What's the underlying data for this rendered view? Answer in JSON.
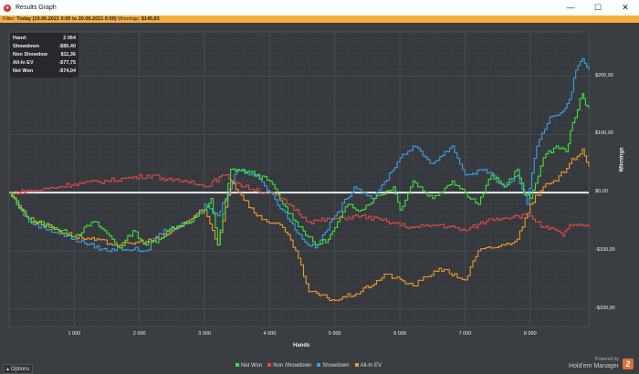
{
  "window": {
    "title": "Results Graph",
    "minimize": "—",
    "maximize": "☐",
    "close": "✕"
  },
  "filter": {
    "label": "Filter:",
    "value": "Today (19.06.2021 0:00 to 20.06.2021 0:00)",
    "winnings_label": "Winnings:",
    "winnings": "$145,83"
  },
  "stats": [
    {
      "label": "Hand:",
      "value": "2 064"
    },
    {
      "label": "Showdown",
      "value": "-$85,40"
    },
    {
      "label": "Non Showdow",
      "value": "$11,36"
    },
    {
      "label": "All-In EV",
      "value": "-$77,75"
    },
    {
      "label": "Net Won",
      "value": "-$74,04"
    }
  ],
  "footer": {
    "options": "Options",
    "powered_by": "Powered by",
    "brand": "Hold'em Manager",
    "brand_mark": "2"
  },
  "chart_data": {
    "type": "line",
    "xlabel": "Hands",
    "ylabel": "Winnings",
    "xlim": [
      0,
      8900
    ],
    "ylim": [
      -230,
      276
    ],
    "xticks": [
      {
        "v": 1000,
        "label": "1 000"
      },
      {
        "v": 2000,
        "label": "2 000"
      },
      {
        "v": 3000,
        "label": "3 000"
      },
      {
        "v": 4000,
        "label": "4 000"
      },
      {
        "v": 5000,
        "label": "5 000"
      },
      {
        "v": 6000,
        "label": "6 000"
      },
      {
        "v": 7000,
        "label": "7 000"
      },
      {
        "v": 8000,
        "label": "8 000"
      }
    ],
    "yticks": [
      {
        "v": 200,
        "label": "$200,00"
      },
      {
        "v": 100,
        "label": "$100,00"
      },
      {
        "v": 0,
        "label": "$0,00"
      },
      {
        "v": -100,
        "label": "-$100,00"
      },
      {
        "v": -200,
        "label": "-$200,00"
      }
    ],
    "legend_position": "bottom",
    "series": [
      {
        "name": "Net Won",
        "color": "#3ee03a",
        "points": [
          [
            0,
            0
          ],
          [
            300,
            -45
          ],
          [
            700,
            -60
          ],
          [
            1000,
            -75
          ],
          [
            1300,
            -50
          ],
          [
            1500,
            -70
          ],
          [
            1700,
            -95
          ],
          [
            1900,
            -65
          ],
          [
            2100,
            -90
          ],
          [
            2300,
            -80
          ],
          [
            2500,
            -60
          ],
          [
            2800,
            -50
          ],
          [
            3000,
            -30
          ],
          [
            3100,
            -10
          ],
          [
            3200,
            -90
          ],
          [
            3400,
            40
          ],
          [
            3700,
            35
          ],
          [
            4000,
            20
          ],
          [
            4200,
            -20
          ],
          [
            4400,
            -50
          ],
          [
            4700,
            -90
          ],
          [
            4900,
            -80
          ],
          [
            5000,
            -60
          ],
          [
            5200,
            -20
          ],
          [
            5400,
            -30
          ],
          [
            5600,
            -10
          ],
          [
            5900,
            10
          ],
          [
            6000,
            -30
          ],
          [
            6200,
            20
          ],
          [
            6500,
            -10
          ],
          [
            6800,
            20
          ],
          [
            7000,
            0
          ],
          [
            7200,
            -20
          ],
          [
            7400,
            30
          ],
          [
            7600,
            10
          ],
          [
            7800,
            40
          ],
          [
            7900,
            0
          ],
          [
            8000,
            -10
          ],
          [
            8200,
            60
          ],
          [
            8400,
            80
          ],
          [
            8550,
            70
          ],
          [
            8650,
            120
          ],
          [
            8800,
            170
          ],
          [
            8850,
            150
          ],
          [
            8900,
            145
          ]
        ]
      },
      {
        "name": "Non Showdown",
        "color": "#e04848",
        "points": [
          [
            0,
            0
          ],
          [
            500,
            5
          ],
          [
            1000,
            15
          ],
          [
            1500,
            20
          ],
          [
            1800,
            25
          ],
          [
            2200,
            30
          ],
          [
            2500,
            20
          ],
          [
            2800,
            20
          ],
          [
            3000,
            10
          ],
          [
            3300,
            30
          ],
          [
            3600,
            10
          ],
          [
            4000,
            0
          ],
          [
            4300,
            -20
          ],
          [
            4600,
            -50
          ],
          [
            5000,
            -45
          ],
          [
            5400,
            -40
          ],
          [
            5800,
            -50
          ],
          [
            6200,
            -60
          ],
          [
            6600,
            -55
          ],
          [
            7000,
            -65
          ],
          [
            7400,
            -45
          ],
          [
            7800,
            -40
          ],
          [
            8000,
            -40
          ],
          [
            8200,
            -60
          ],
          [
            8400,
            -65
          ],
          [
            8500,
            -75
          ],
          [
            8600,
            -55
          ],
          [
            8900,
            -60
          ]
        ]
      },
      {
        "name": "Showdown",
        "color": "#3a9ee0",
        "points": [
          [
            0,
            0
          ],
          [
            300,
            -50
          ],
          [
            1000,
            -80
          ],
          [
            1500,
            -100
          ],
          [
            1700,
            -95
          ],
          [
            2100,
            -100
          ],
          [
            2300,
            -70
          ],
          [
            2800,
            -50
          ],
          [
            3000,
            -20
          ],
          [
            3200,
            -40
          ],
          [
            3500,
            40
          ],
          [
            3800,
            30
          ],
          [
            4000,
            0
          ],
          [
            4200,
            -30
          ],
          [
            4500,
            -80
          ],
          [
            4700,
            -95
          ],
          [
            5000,
            -40
          ],
          [
            5300,
            10
          ],
          [
            5600,
            -10
          ],
          [
            6000,
            60
          ],
          [
            6200,
            80
          ],
          [
            6500,
            50
          ],
          [
            6800,
            80
          ],
          [
            7000,
            30
          ],
          [
            7300,
            40
          ],
          [
            7600,
            10
          ],
          [
            7800,
            30
          ],
          [
            7950,
            -20
          ],
          [
            8100,
            80
          ],
          [
            8300,
            130
          ],
          [
            8500,
            140
          ],
          [
            8600,
            160
          ],
          [
            8700,
            210
          ],
          [
            8800,
            230
          ],
          [
            8900,
            210
          ]
        ]
      },
      {
        "name": "All-In EV",
        "color": "#f0962a",
        "points": [
          [
            0,
            0
          ],
          [
            300,
            -45
          ],
          [
            1000,
            -75
          ],
          [
            1700,
            -90
          ],
          [
            2300,
            -80
          ],
          [
            3000,
            -30
          ],
          [
            3200,
            -90
          ],
          [
            3400,
            20
          ],
          [
            3800,
            -40
          ],
          [
            4200,
            -60
          ],
          [
            4400,
            -100
          ],
          [
            4600,
            -170
          ],
          [
            5000,
            -185
          ],
          [
            5400,
            -170
          ],
          [
            5800,
            -140
          ],
          [
            6200,
            -160
          ],
          [
            6600,
            -130
          ],
          [
            7000,
            -150
          ],
          [
            7200,
            -100
          ],
          [
            7600,
            -90
          ],
          [
            7800,
            -80
          ],
          [
            8000,
            -20
          ],
          [
            8200,
            10
          ],
          [
            8400,
            20
          ],
          [
            8600,
            50
          ],
          [
            8800,
            75
          ],
          [
            8900,
            45
          ]
        ]
      }
    ]
  }
}
